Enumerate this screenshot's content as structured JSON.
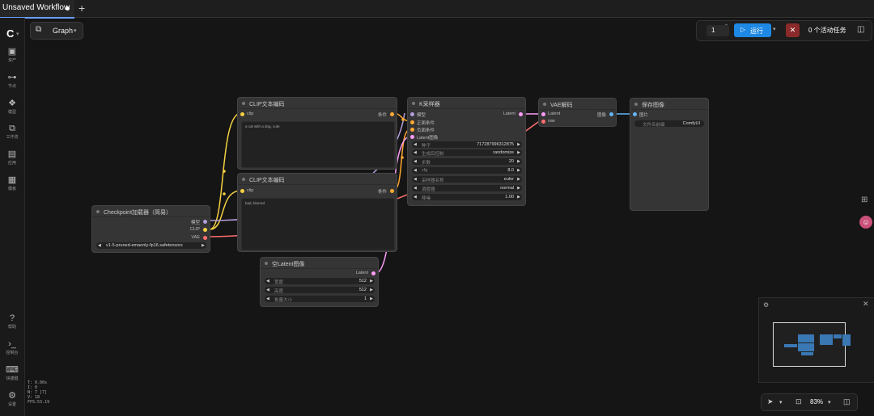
{
  "tabbar": {
    "tab_title": "Unsaved Workflow",
    "add_icon": "plus-icon"
  },
  "sidebar": {
    "logo": "C",
    "items": [
      {
        "label": "资产",
        "icon": "image-icon",
        "glyph": "▣"
      },
      {
        "label": "节点",
        "icon": "node-icon",
        "glyph": "⊶"
      },
      {
        "label": "模型",
        "icon": "model-icon",
        "glyph": "❖"
      },
      {
        "label": "工作流",
        "icon": "workflow-icon",
        "glyph": "⧉"
      },
      {
        "label": "应用",
        "icon": "apps-icon",
        "glyph": "▤"
      },
      {
        "label": "模板",
        "icon": "template-icon",
        "glyph": "▦"
      }
    ],
    "bottom_items": [
      {
        "label": "帮助",
        "icon": "help-icon",
        "glyph": "?"
      },
      {
        "label": "控制台",
        "icon": "console-icon",
        "glyph": "›_"
      },
      {
        "label": "快捷键",
        "icon": "keyboard-icon",
        "glyph": "⌨"
      },
      {
        "label": "设置",
        "icon": "gear-icon",
        "glyph": "⚙"
      }
    ]
  },
  "stats": {
    "t": "T: 0.00s",
    "i": "I: 0",
    "n": "N: 7 [7]",
    "v": "V: 18",
    "fps": "FPS:53.19"
  },
  "toolbar": {
    "graph_label": "Graph",
    "queue_count": "1",
    "run_label": "运行",
    "stop_icon": "✕",
    "tasks_label": "0 个活动任务"
  },
  "nodes": {
    "clip_pos": {
      "title": "CLIP文本编码",
      "in_clip": "clip",
      "out": "条件",
      "text": "a cat with a dog, cute"
    },
    "clip_neg": {
      "title": "CLIP文本编码",
      "in_clip": "clip",
      "out": "条件",
      "text": "bad, blurred"
    },
    "checkpoint": {
      "title": "Checkpoint加载器（简易）",
      "out_model": "模型",
      "out_clip": "CLIP",
      "out_vae": "VAE",
      "ckpt": "v1-5-pruned-emaonly-fp16.safetensors"
    },
    "ksampler": {
      "title": "K采样器",
      "inputs": [
        "模型",
        "正面条件",
        "负面条件",
        "Latent图像"
      ],
      "out": "Latent",
      "widgets": [
        {
          "label": "种子",
          "value": "717287996312875"
        },
        {
          "label": "生成后控制",
          "value": "randomize"
        },
        {
          "label": "步数",
          "value": "20"
        },
        {
          "label": "cfg",
          "value": "8.0"
        },
        {
          "label": "采样器名称",
          "value": "euler"
        },
        {
          "label": "调度器",
          "value": "normal"
        },
        {
          "label": "降噪",
          "value": "1.00"
        }
      ]
    },
    "vae": {
      "title": "VAE解码",
      "in_latent": "Latent",
      "in_vae": "vae",
      "out": "图像"
    },
    "save": {
      "title": "保存图像",
      "in": "图片",
      "prefix_label": "文件名前缀",
      "prefix_value": "ComfyUI"
    },
    "latent": {
      "title": "空Latent图像",
      "out": "Latent",
      "widgets": [
        {
          "label": "宽度",
          "value": "512"
        },
        {
          "label": "高度",
          "value": "512"
        },
        {
          "label": "批量大小",
          "value": "1"
        }
      ]
    }
  },
  "zoom": {
    "percent": "83%"
  },
  "colors": {
    "accent": "#1e88e5",
    "clip_wire": "#f5d142",
    "model_wire": "#b39ddb",
    "vae_wire": "#ff6e6e",
    "cond_wire": "#ffa931",
    "latent_wire": "#ff9cf9",
    "image_wire": "#64b5f6"
  }
}
